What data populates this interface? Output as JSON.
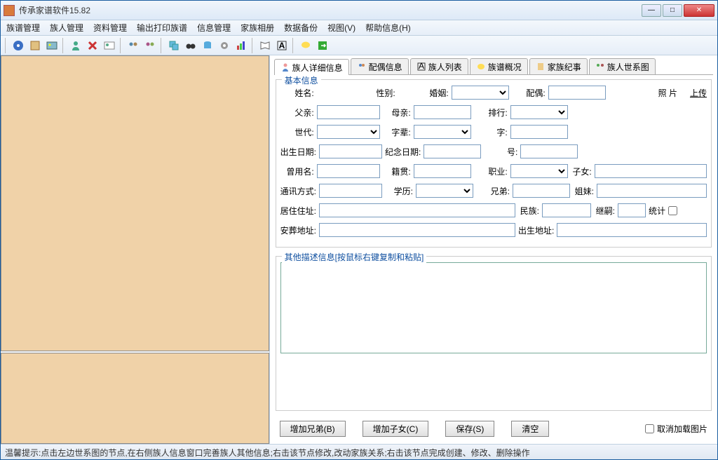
{
  "window": {
    "title": "传承家谱软件15.82"
  },
  "menu": [
    "族谱管理",
    "族人管理",
    "资料管理",
    "输出打印族谱",
    "信息管理",
    "家族相册",
    "数据备份",
    "视图(V)",
    "帮助信息(H)"
  ],
  "tabs": [
    {
      "label": "族人详细信息",
      "icon": "person"
    },
    {
      "label": "配偶信息",
      "icon": "couple"
    },
    {
      "label": "族人列表",
      "icon": "list"
    },
    {
      "label": "族谱概况",
      "icon": "book"
    },
    {
      "label": "家族纪事",
      "icon": "scroll"
    },
    {
      "label": "族人世系图",
      "icon": "tree"
    }
  ],
  "group_basic": "基本信息",
  "labels": {
    "name": "姓名:",
    "gender": "性别:",
    "marriage": "婚姻:",
    "spouse": "配偶:",
    "father": "父亲:",
    "mother": "母亲:",
    "rank": "排行:",
    "generation": "世代:",
    "zibei": "字辈:",
    "zi": "字:",
    "birth": "出生日期:",
    "memorial": "纪念日期:",
    "hao": "号:",
    "oldname": "曾用名:",
    "native": "籍贯:",
    "job": "职业:",
    "children": "子女:",
    "contact": "通讯方式:",
    "edu": "学历:",
    "brothers": "兄弟:",
    "sisters": "姐妹:",
    "addr": "居住住址:",
    "nation": "民族:",
    "jisi": "继嗣:",
    "stat": "统计",
    "burial": "安葬地址:",
    "birthplace": "出生地址:",
    "photo": "照  片",
    "upload": "上传"
  },
  "group_desc": "其他描述信息[按鼠标右键复制和粘贴]",
  "buttons": {
    "add_brother": "增加兄弟(B)",
    "add_child": "增加子女(C)",
    "save": "保存(S)",
    "clear": "清空"
  },
  "checkbox": "取消加载图片",
  "statusbar": "温馨提示:点击左边世系图的节点,在右侧族人信息窗口完善族人其他信息;右击该节点修改,改动家族关系;右击该节点完成创建、修改、删除操作"
}
